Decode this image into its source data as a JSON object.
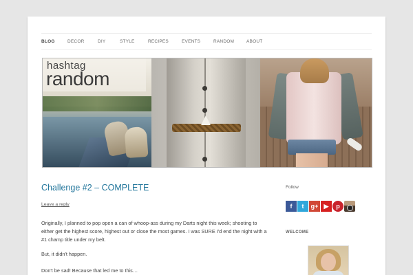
{
  "nav": {
    "items": [
      "BLOG",
      "DECOR",
      "DIY",
      "STYLE",
      "RECIPES",
      "EVENTS",
      "RANDOM",
      "ABOUT"
    ],
    "active": "BLOG"
  },
  "banner": {
    "logo_line1": "hashtag",
    "logo_line2": "random"
  },
  "post": {
    "title": "Challenge #2 – COMPLETE",
    "reply_link": "Leave a reply",
    "paragraphs": [
      "Originally, I planned to pop open a can of whoop-ass during my Darts night this week; shooting to either get the highest score, highest out or close the most games. I was SURE I'd end the night with a #1 champ title under my belt.",
      "But, it didn't happen.",
      "Don't be sad! Because that led me to this…"
    ]
  },
  "sidebar": {
    "follow_label": "Follow",
    "social_icons": [
      {
        "name": "facebook-icon",
        "glyph": "f"
      },
      {
        "name": "twitter-icon",
        "glyph": "t"
      },
      {
        "name": "google-plus-icon",
        "glyph": "g+"
      },
      {
        "name": "youtube-icon",
        "glyph": "▶"
      },
      {
        "name": "pinterest-icon",
        "glyph": "p"
      },
      {
        "name": "instagram-icon",
        "glyph": ""
      }
    ],
    "welcome_heading": "WELCOME"
  },
  "colors": {
    "link": "#21759b",
    "background": "#e6e6e6"
  }
}
